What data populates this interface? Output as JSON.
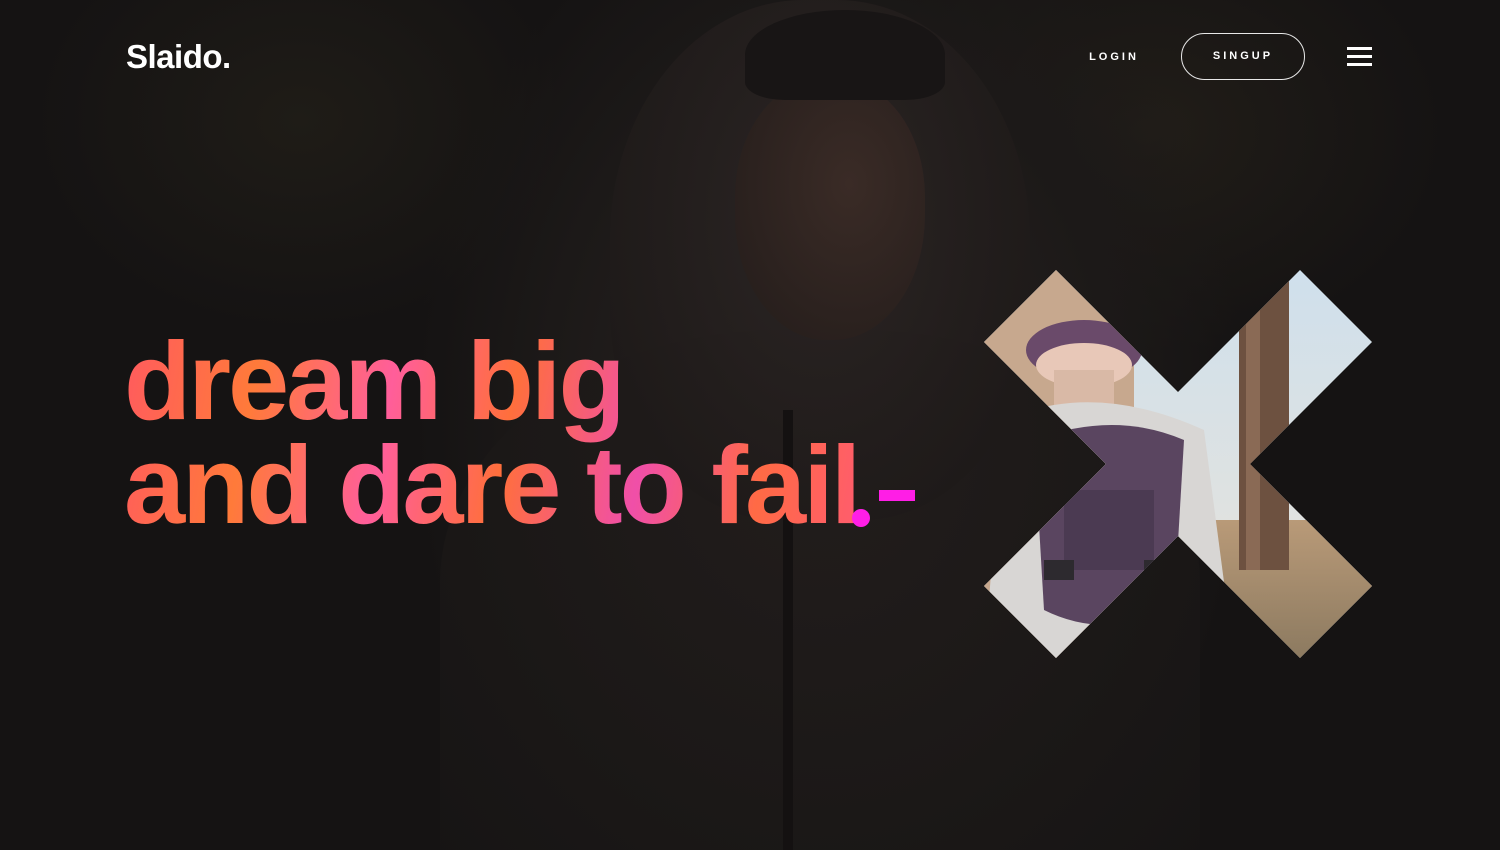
{
  "header": {
    "logo": "Slaido.",
    "login_label": "LOGIN",
    "signup_label": "SINGUP"
  },
  "hero": {
    "headline_line1": "dream big",
    "headline_line2": "and dare to fail"
  },
  "colors": {
    "accent": "#ff1ee6",
    "gradient_orange": "#ff7a3a",
    "gradient_pink": "#f04fa8",
    "background": "#151313",
    "text": "#ffffff"
  },
  "icons": {
    "menu": "hamburger-menu-icon"
  }
}
